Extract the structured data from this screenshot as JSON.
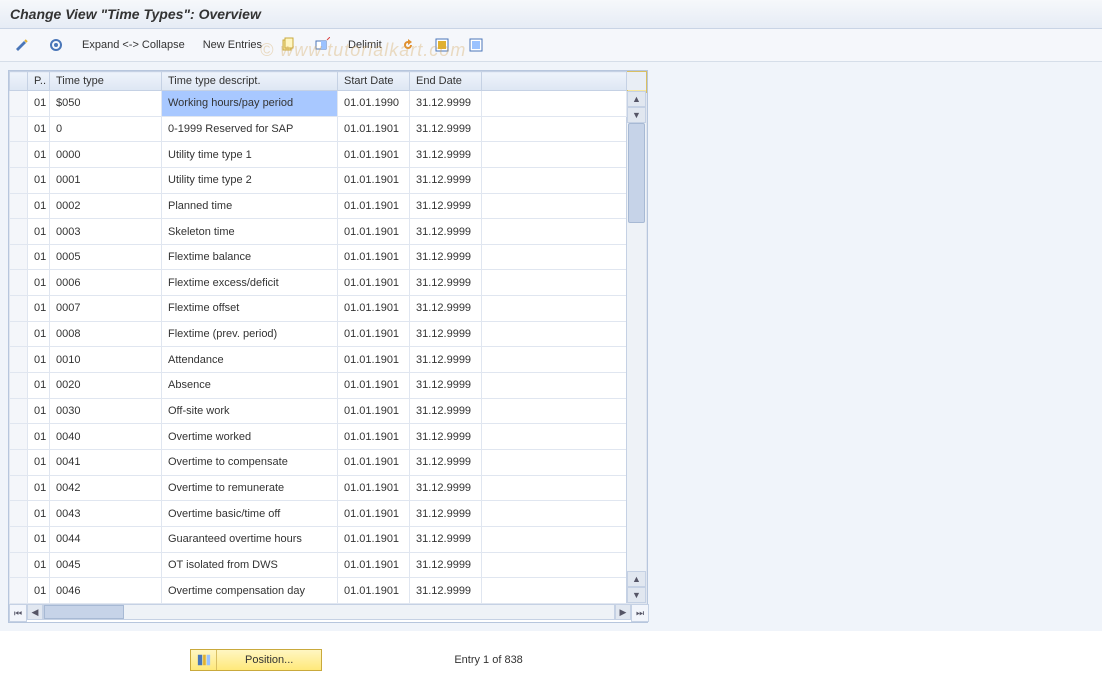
{
  "title": "Change View \"Time Types\": Overview",
  "watermark": "© www.tutorialkart.com",
  "toolbar": {
    "expand_collapse": "Expand <-> Collapse",
    "new_entries": "New Entries",
    "delimit": "Delimit"
  },
  "table": {
    "headers": {
      "p": "P..",
      "time_type": "Time type",
      "descript": "Time type descript.",
      "start_date": "Start Date",
      "end_date": "End Date"
    },
    "rows": [
      {
        "p": "01",
        "tt": "$050",
        "desc": "Working hours/pay period",
        "start": "01.01.1990",
        "end": "31.12.9999",
        "hl": true
      },
      {
        "p": "01",
        "tt": "0",
        "desc": "0-1999 Reserved for SAP",
        "start": "01.01.1901",
        "end": "31.12.9999"
      },
      {
        "p": "01",
        "tt": "0000",
        "desc": "Utility time type 1",
        "start": "01.01.1901",
        "end": "31.12.9999"
      },
      {
        "p": "01",
        "tt": "0001",
        "desc": "Utility time type 2",
        "start": "01.01.1901",
        "end": "31.12.9999"
      },
      {
        "p": "01",
        "tt": "0002",
        "desc": "Planned time",
        "start": "01.01.1901",
        "end": "31.12.9999"
      },
      {
        "p": "01",
        "tt": "0003",
        "desc": "Skeleton time",
        "start": "01.01.1901",
        "end": "31.12.9999"
      },
      {
        "p": "01",
        "tt": "0005",
        "desc": "Flextime balance",
        "start": "01.01.1901",
        "end": "31.12.9999"
      },
      {
        "p": "01",
        "tt": "0006",
        "desc": "Flextime excess/deficit",
        "start": "01.01.1901",
        "end": "31.12.9999"
      },
      {
        "p": "01",
        "tt": "0007",
        "desc": "Flextime offset",
        "start": "01.01.1901",
        "end": "31.12.9999"
      },
      {
        "p": "01",
        "tt": "0008",
        "desc": "Flextime (prev. period)",
        "start": "01.01.1901",
        "end": "31.12.9999"
      },
      {
        "p": "01",
        "tt": "0010",
        "desc": "Attendance",
        "start": "01.01.1901",
        "end": "31.12.9999"
      },
      {
        "p": "01",
        "tt": "0020",
        "desc": "Absence",
        "start": "01.01.1901",
        "end": "31.12.9999"
      },
      {
        "p": "01",
        "tt": "0030",
        "desc": "Off-site work",
        "start": "01.01.1901",
        "end": "31.12.9999"
      },
      {
        "p": "01",
        "tt": "0040",
        "desc": "Overtime worked",
        "start": "01.01.1901",
        "end": "31.12.9999"
      },
      {
        "p": "01",
        "tt": "0041",
        "desc": "Overtime to compensate",
        "start": "01.01.1901",
        "end": "31.12.9999"
      },
      {
        "p": "01",
        "tt": "0042",
        "desc": "Overtime to remunerate",
        "start": "01.01.1901",
        "end": "31.12.9999"
      },
      {
        "p": "01",
        "tt": "0043",
        "desc": "Overtime basic/time off",
        "start": "01.01.1901",
        "end": "31.12.9999"
      },
      {
        "p": "01",
        "tt": "0044",
        "desc": "Guaranteed overtime hours",
        "start": "01.01.1901",
        "end": "31.12.9999"
      },
      {
        "p": "01",
        "tt": "0045",
        "desc": "OT isolated from DWS",
        "start": "01.01.1901",
        "end": "31.12.9999"
      },
      {
        "p": "01",
        "tt": "0046",
        "desc": "Overtime compensation day",
        "start": "01.01.1901",
        "end": "31.12.9999"
      }
    ]
  },
  "footer": {
    "position_label": "Position...",
    "status": "Entry 1 of 838"
  }
}
